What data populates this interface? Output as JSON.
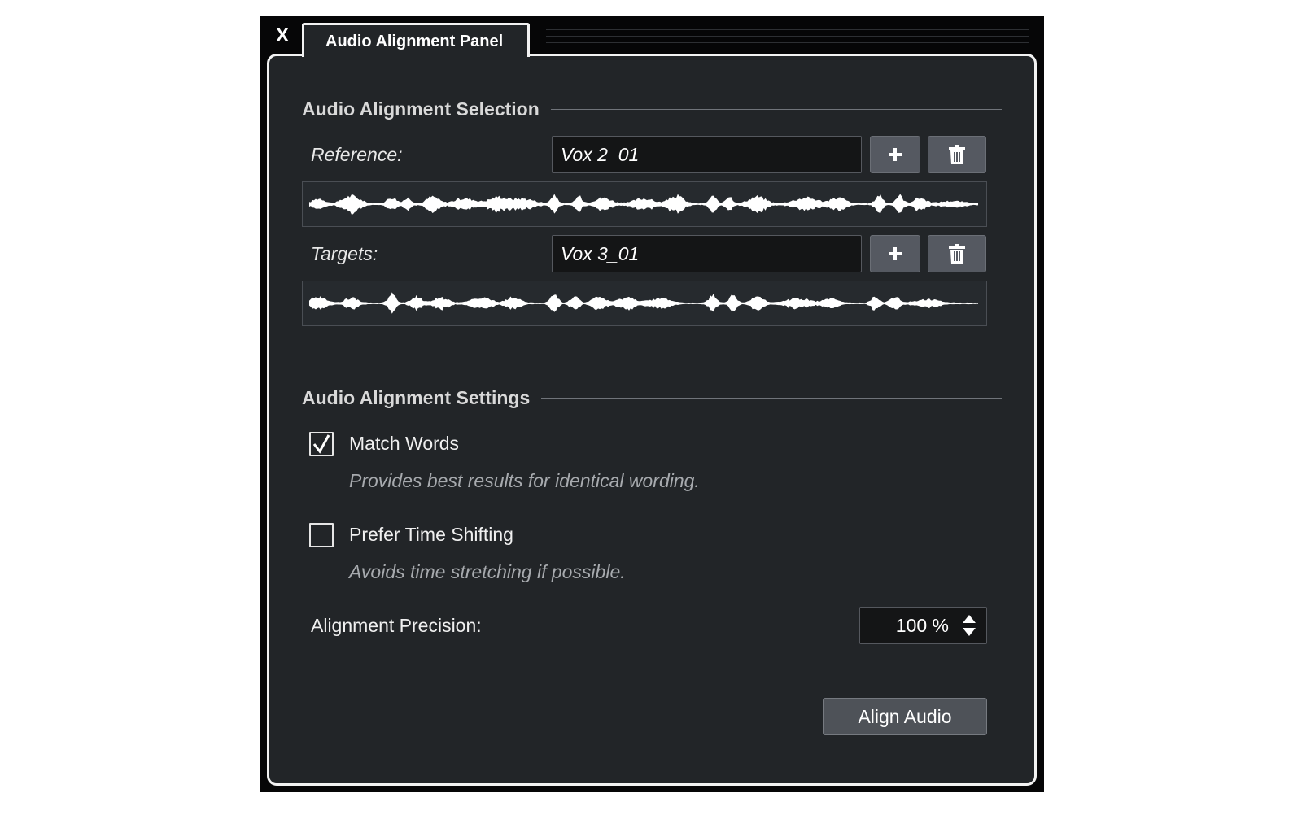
{
  "window": {
    "close_label": "X",
    "tab_title": "Audio Alignment Panel"
  },
  "selection": {
    "title": "Audio Alignment Selection",
    "reference": {
      "label": "Reference:",
      "value": "Vox 2_01",
      "add_icon": "plus-icon",
      "remove_icon": "trash-icon"
    },
    "targets": {
      "label": "Targets:",
      "value": "Vox 3_01",
      "add_icon": "plus-icon",
      "remove_icon": "trash-icon"
    }
  },
  "settings": {
    "title": "Audio Alignment Settings",
    "match_words": {
      "label": "Match Words",
      "description": "Provides best results for identical wording.",
      "checked": true
    },
    "prefer_time_shifting": {
      "label": "Prefer Time Shifting",
      "description": "Avoids time stretching if possible.",
      "checked": false
    },
    "precision": {
      "label": "Alignment Precision:",
      "value": "100 %"
    }
  },
  "actions": {
    "align_label": "Align Audio"
  },
  "colors": {
    "panel_bg": "#222528",
    "outer_bg": "#060607",
    "border": "#f2f2f2",
    "button_bg": "#555961",
    "field_bg": "#141516",
    "waveform": "#ffffff"
  }
}
